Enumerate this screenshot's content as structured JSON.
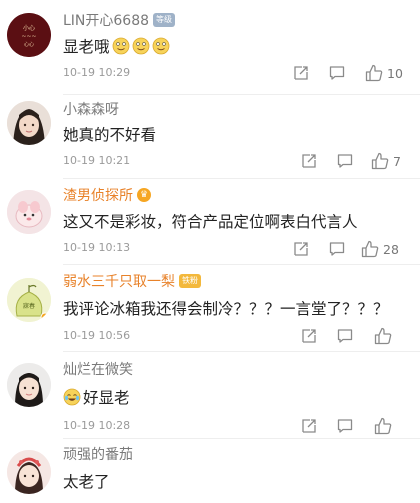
{
  "comments": [
    {
      "user": "LIN开心6688",
      "badge": "等级",
      "text": "显老哦",
      "time": "10-19 10:29",
      "likes": "10",
      "name_color": "gray"
    },
    {
      "user": "小森森呀",
      "text": "她真的不好看",
      "time": "10-19 10:21",
      "likes": "7",
      "name_color": "gray"
    },
    {
      "user": "渣男侦探所",
      "text": "这又不是彩妆，符合产品定位啊表白代言人",
      "time": "10-19 10:13",
      "likes": "28",
      "name_color": "orange"
    },
    {
      "user": "弱水三千只取一梨",
      "badge": "铁粉",
      "text": "我评论冰箱我还得会制冷？？？一言堂了？？？",
      "time": "10-19 10:56",
      "likes": "",
      "name_color": "orange"
    },
    {
      "user": "灿烂在微笑",
      "text": "好显老",
      "time": "10-19 10:28",
      "likes": "",
      "name_color": "gray"
    },
    {
      "user": "顽强的番茄",
      "text": "太老了",
      "time": "",
      "likes": "",
      "name_color": "gray"
    }
  ],
  "colors": {
    "accent_orange": "#e8822a",
    "meta_gray": "#9a9a9a",
    "icon_gray": "#8a8a8a"
  },
  "icons": [
    "share-icon",
    "comment-icon",
    "like-icon",
    "grin-emoji-icon",
    "laugh-cry-emoji-icon",
    "vip-crown-icon"
  ]
}
